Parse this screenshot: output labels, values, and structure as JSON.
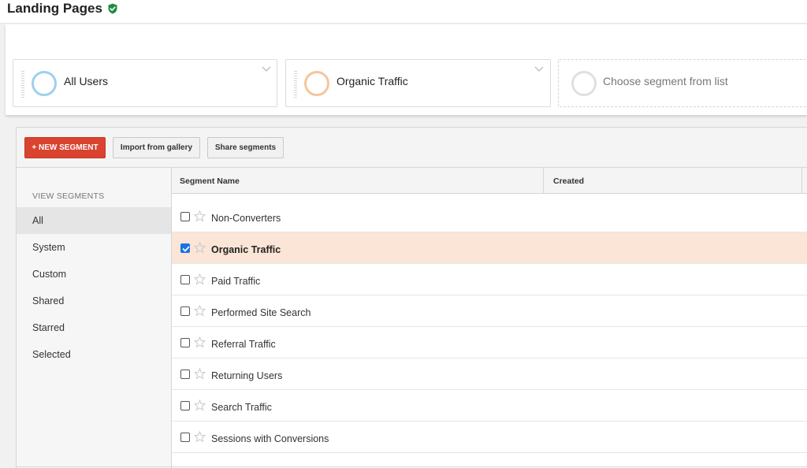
{
  "header": {
    "title": "Landing Pages",
    "verified_icon": "check-shield-icon",
    "verified_color": "#1e8e3e"
  },
  "segments": [
    {
      "label": "All Users",
      "color": "#9fd0ec",
      "icon": "segment-circle-icon"
    },
    {
      "label": "Organic Traffic",
      "color": "#f5c59a",
      "icon": "segment-circle-icon"
    },
    {
      "label": "Choose segment from list",
      "color": "#e0e0e0",
      "icon": "segment-circle-icon"
    }
  ],
  "toolbar": {
    "new_segment_label": "+ NEW SEGMENT",
    "import_label": "Import from gallery",
    "share_label": "Share segments",
    "accent_color": "#d9432f"
  },
  "sidebar": {
    "heading": "VIEW SEGMENTS",
    "items": [
      {
        "label": "All",
        "active": true
      },
      {
        "label": "System",
        "active": false
      },
      {
        "label": "Custom",
        "active": false
      },
      {
        "label": "Shared",
        "active": false
      },
      {
        "label": "Starred",
        "active": false
      },
      {
        "label": "Selected",
        "active": false
      }
    ]
  },
  "table": {
    "columns": [
      "Segment Name",
      "Created"
    ],
    "rows": [
      {
        "name": "Non-Converters",
        "checked": false
      },
      {
        "name": "Organic Traffic",
        "checked": true
      },
      {
        "name": "Paid Traffic",
        "checked": false
      },
      {
        "name": "Performed Site Search",
        "checked": false
      },
      {
        "name": "Referral Traffic",
        "checked": false
      },
      {
        "name": "Returning Users",
        "checked": false
      },
      {
        "name": "Search Traffic",
        "checked": false
      },
      {
        "name": "Sessions with Conversions",
        "checked": false
      }
    ],
    "selected_row_color": "#fbe5d6"
  }
}
